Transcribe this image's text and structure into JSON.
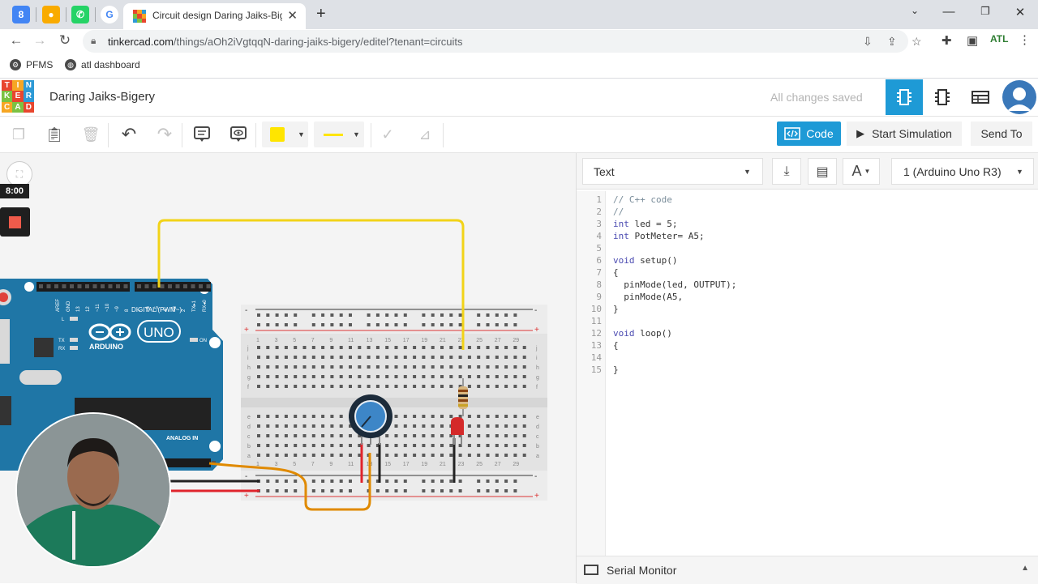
{
  "browser": {
    "pinned_tabs": [
      {
        "name": "pinned-tab-calendar",
        "glyph": "8",
        "color": "#4285f4"
      },
      {
        "name": "pinned-tab-keep",
        "glyph": "●",
        "color": "#f9ab00"
      },
      {
        "name": "pinned-tab-whatsapp",
        "glyph": "✆",
        "color": "#25d366"
      },
      {
        "name": "pinned-tab-google",
        "glyph": "G",
        "color": "#ffffff"
      }
    ],
    "active_tab_title": "Circuit design Daring Jaiks-Bigery",
    "tab_close": "✕",
    "new_tab": "+",
    "url_host": "tinkercad.com",
    "url_path": "/things/aOh2iVgtqqN-daring-jaiks-bigery/editel?tenant=circuits",
    "bookmarks": [
      {
        "label": "PFMS"
      },
      {
        "label": "atl dashboard"
      }
    ]
  },
  "app": {
    "logo_letters": [
      "TIN",
      "KER",
      "CAD"
    ],
    "design_name": "Daring Jaiks-Bigery",
    "save_status": "All changes saved"
  },
  "toolbar": {
    "code_label": "Code",
    "start_sim_label": "Start Simulation",
    "send_to_label": "Send To",
    "wire_color": "#ffe500"
  },
  "canvas": {
    "timer": "8:00"
  },
  "code_panel": {
    "mode": "Text",
    "board": "1 (Arduino Uno R3)",
    "serial_monitor_label": "Serial Monitor",
    "lines": [
      {
        "n": "1",
        "segments": [
          {
            "t": "// C++ code",
            "c": "com"
          }
        ]
      },
      {
        "n": "2",
        "segments": [
          {
            "t": "//",
            "c": "com"
          }
        ]
      },
      {
        "n": "3",
        "segments": [
          {
            "t": "int",
            "c": "kw"
          },
          {
            "t": " led = 5;",
            "c": ""
          }
        ]
      },
      {
        "n": "4",
        "segments": [
          {
            "t": "int",
            "c": "kw"
          },
          {
            "t": " PotMeter= A5;",
            "c": ""
          }
        ]
      },
      {
        "n": "5",
        "segments": []
      },
      {
        "n": "6",
        "segments": [
          {
            "t": "void",
            "c": "kw"
          },
          {
            "t": " setup()",
            "c": ""
          }
        ]
      },
      {
        "n": "7",
        "segments": [
          {
            "t": "{",
            "c": ""
          }
        ]
      },
      {
        "n": "8",
        "segments": [
          {
            "t": "  pinMode(led, OUTPUT);",
            "c": ""
          }
        ]
      },
      {
        "n": "9",
        "segments": [
          {
            "t": "  pinMode(A5,",
            "c": ""
          }
        ]
      },
      {
        "n": "10",
        "segments": [
          {
            "t": "}",
            "c": ""
          }
        ]
      },
      {
        "n": "11",
        "segments": []
      },
      {
        "n": "12",
        "segments": [
          {
            "t": "void",
            "c": "kw"
          },
          {
            "t": " loop()",
            "c": ""
          }
        ]
      },
      {
        "n": "13",
        "segments": [
          {
            "t": "{",
            "c": ""
          }
        ]
      },
      {
        "n": "14",
        "segments": []
      },
      {
        "n": "15",
        "segments": [
          {
            "t": "}",
            "c": ""
          }
        ]
      }
    ]
  },
  "arduino": {
    "board_label": "UNO",
    "brand": "ARDUINO",
    "digital_label": "DIGITAL (PWM~)",
    "analog_label": "ANALOG IN",
    "aref_label": "AREF",
    "gnd_label": "GND",
    "pin_labels": [
      "13",
      "12",
      "~11",
      "~10",
      "~9",
      "8",
      "7",
      "~6",
      "~5",
      "4",
      "~3",
      "2",
      "TX▸1",
      "RX◂0"
    ],
    "tx_label": "TX",
    "rx_label": "RX",
    "l_label": "L",
    "on_label": "ON"
  },
  "breadboard": {
    "col_numbers": [
      "1",
      "3",
      "5",
      "7",
      "9",
      "11",
      "13",
      "15",
      "17",
      "19",
      "21",
      "23",
      "25",
      "27",
      "29"
    ],
    "row_letters_top": [
      "j",
      "i",
      "h",
      "g",
      "f"
    ],
    "row_letters_bottom": [
      "e",
      "d",
      "c",
      "b",
      "a"
    ],
    "plus": "+",
    "minus": "-"
  }
}
